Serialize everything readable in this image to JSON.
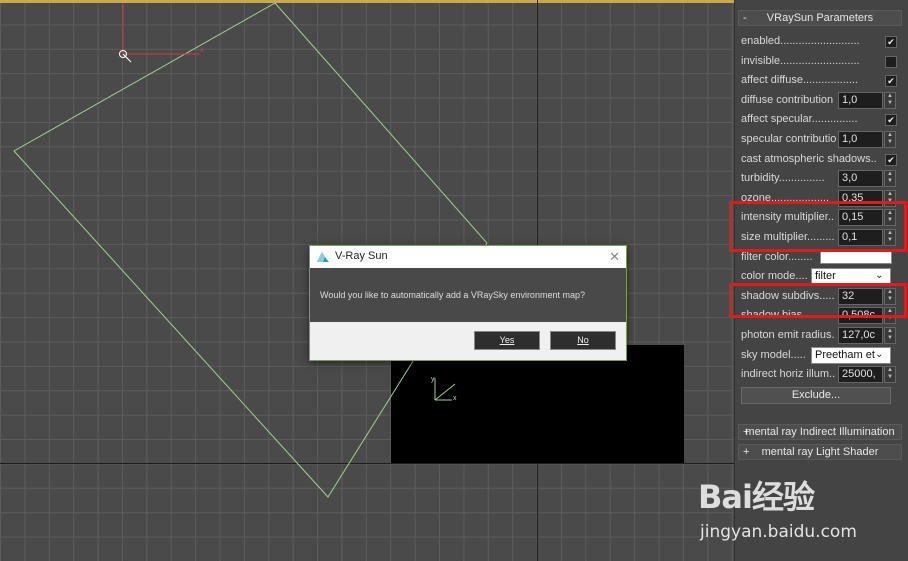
{
  "viewport": {
    "axis_x_label": "x",
    "axis_y_label": "y"
  },
  "panel": {
    "rollout_title": "VRaySun Parameters",
    "rollout_sign": "-",
    "params": [
      {
        "label": "enabled..........................",
        "type": "check",
        "checked": true
      },
      {
        "label": "invisible..........................",
        "type": "check",
        "checked": false
      },
      {
        "label": "affect diffuse..................",
        "type": "check",
        "checked": true
      },
      {
        "label": "diffuse contribution",
        "type": "spin",
        "value": "1,0"
      },
      {
        "label": "affect specular...............",
        "type": "check",
        "checked": true
      },
      {
        "label": "specular contributio",
        "type": "spin",
        "value": "1,0"
      },
      {
        "label": "cast atmospheric shadows..",
        "type": "check",
        "checked": true
      },
      {
        "label": "turbidity...............",
        "type": "spin",
        "value": "3,0"
      },
      {
        "label": "ozone...................",
        "type": "spin",
        "value": "0,35"
      },
      {
        "label": "intensity multiplier..",
        "type": "spin",
        "value": "0,15"
      },
      {
        "label": "size multiplier.........",
        "type": "spin",
        "value": "0,1"
      },
      {
        "label": "filter color........",
        "type": "swatch",
        "color": "#ffffff"
      },
      {
        "label": "color mode....",
        "type": "drop",
        "value": "filter"
      },
      {
        "label": "shadow subdivs.....",
        "type": "spin",
        "value": "32"
      },
      {
        "label": "shadow bias..........",
        "type": "spin",
        "value": "0,508c"
      },
      {
        "label": "photon emit radius.",
        "type": "spin",
        "value": "127,0c"
      },
      {
        "label": "sky model.....",
        "type": "drop",
        "value": "Preetham et"
      },
      {
        "label": "indirect horiz illum..",
        "type": "spin",
        "value": "25000,"
      }
    ],
    "exclude_label": "Exclude...",
    "collapsed_rollouts": [
      {
        "sign": "+",
        "label": "mental ray Indirect Illumination"
      },
      {
        "sign": "+",
        "label": "mental ray Light Shader"
      }
    ]
  },
  "dialog": {
    "title": "V-Ray Sun",
    "close_glyph": "✕",
    "message": "Would you like to automatically add a VRaySky environment map?",
    "yes_label": "Yes",
    "no_label": "No"
  },
  "watermark": {
    "logo": "Bai经验",
    "url": "jingyan.baidu.com"
  },
  "colors": {
    "highlight": "#e21a1a",
    "viewport_bg": "#4a4a4a",
    "light_shape": "#9fd08a"
  }
}
